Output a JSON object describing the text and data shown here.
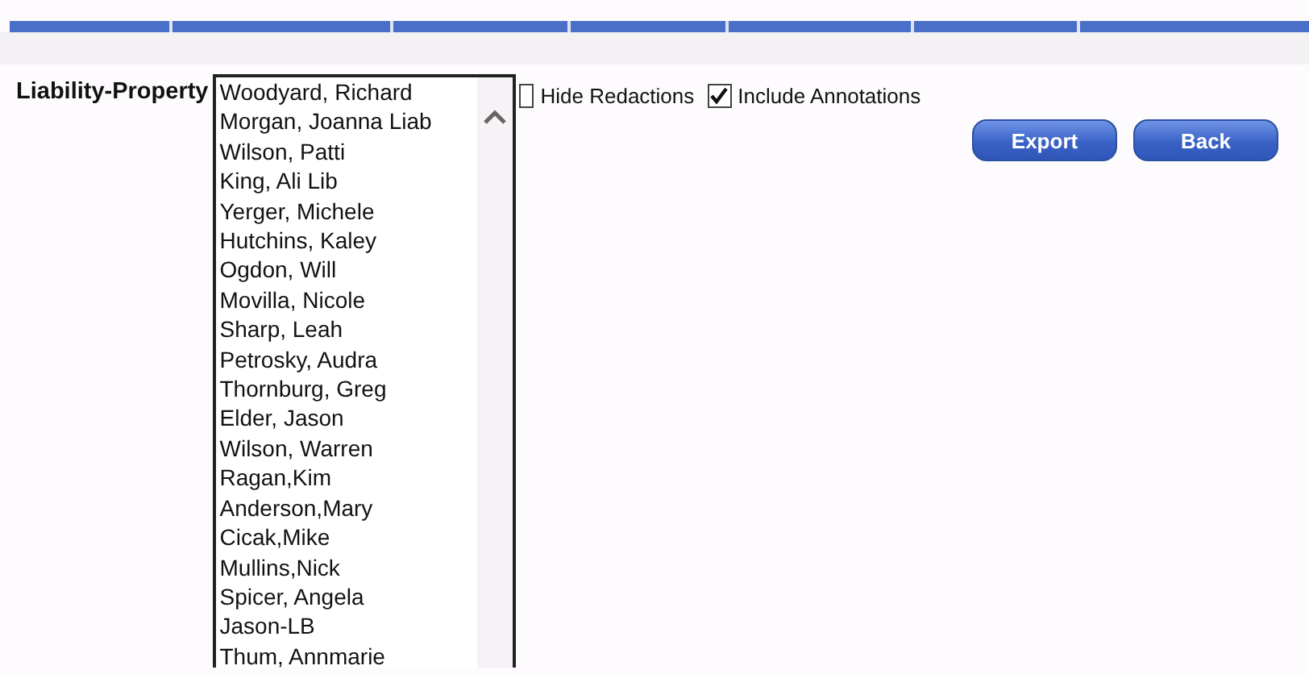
{
  "label": "Liability-Property",
  "list": {
    "items": [
      {
        "name": "Woodyard, Richard"
      },
      {
        "name": "Morgan, Joanna Liab"
      },
      {
        "name": "Wilson, Patti"
      },
      {
        "name": "King, Ali Lib"
      },
      {
        "name": "Yerger, Michele"
      },
      {
        "name": "Hutchins, Kaley"
      },
      {
        "name": "Ogdon, Will"
      },
      {
        "name": "Movilla, Nicole"
      },
      {
        "name": "Sharp, Leah"
      },
      {
        "name": "Petrosky, Audra"
      },
      {
        "name": "Thornburg, Greg"
      },
      {
        "name": "Elder, Jason"
      },
      {
        "name": "Wilson, Warren"
      },
      {
        "name": "Ragan,Kim"
      },
      {
        "name": "Anderson,Mary"
      },
      {
        "name": "Cicak,Mike"
      },
      {
        "name": "Mullins,Nick"
      },
      {
        "name": "Spicer, Angela"
      },
      {
        "name": "Jason-LB"
      },
      {
        "name": "Thum, Annmarie"
      }
    ]
  },
  "options": [
    {
      "label": "Hide Redactions",
      "checked": false
    },
    {
      "label": "Include Annotations",
      "checked": true
    }
  ],
  "buttons": [
    "Export",
    "Back"
  ]
}
